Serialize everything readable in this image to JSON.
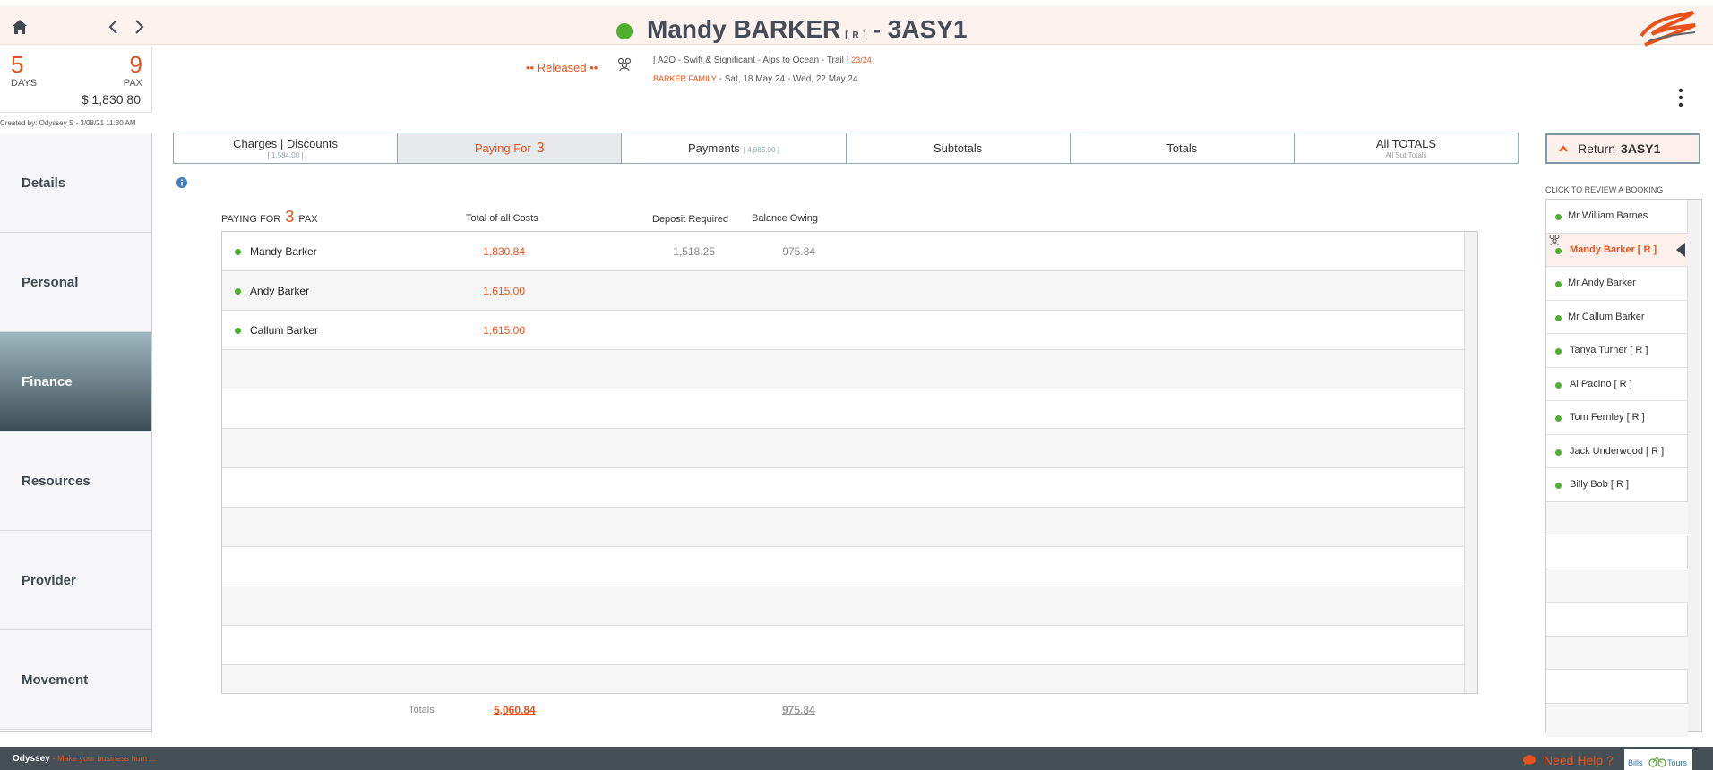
{
  "header": {
    "name": "Mandy BARKER",
    "r_tag": "[ R ]",
    "code": "- 3ASY1",
    "status_color": "#4caf2d"
  },
  "summary": {
    "days": "5",
    "days_label": "DAYS",
    "pax": "9",
    "pax_label": "PAX",
    "amount": "$ 1,830.80",
    "created_by": "Created by: Odyssey S - 3/08/21 11:30 AM"
  },
  "booking": {
    "status": "•• Released ••",
    "trip": "[ A2O - Swift & Significant - Alps to Ocean - Trail ]",
    "trip_ref": "23/24",
    "family": "BARKER FAMILY",
    "dates": "- Sat, 18 May 24 - Wed, 22 May 24"
  },
  "sidebar": {
    "items": [
      {
        "label": "Details"
      },
      {
        "label": "Personal"
      },
      {
        "label": "Finance"
      },
      {
        "label": "Resources"
      },
      {
        "label": "Provider"
      },
      {
        "label": "Movement"
      }
    ]
  },
  "tabs": {
    "charges": "Charges | Discounts",
    "charges_sub": "[ 1,584.00 ]",
    "paying": "Paying For",
    "paying_count": "3",
    "payments": "Payments",
    "payments_sub": "[ 4,085.00 ]",
    "subtotals": "Subtotals",
    "totals": "Totals",
    "all_totals": "All TOTALS",
    "all_totals_sub": "All SubTotals"
  },
  "return_btn": {
    "label": "Return",
    "code": "3ASY1"
  },
  "review": {
    "header": "CLICK TO REVIEW A BOOKING",
    "items": [
      {
        "label": "Mr William Barnes"
      },
      {
        "label": "Mandy Barker  [ R ]"
      },
      {
        "label": "Mr Andy Barker"
      },
      {
        "label": "Mr Callum Barker"
      },
      {
        "label": "Tanya Turner   [ R ]"
      },
      {
        "label": "Al Pacino   [ R ]"
      },
      {
        "label": "Tom Fernley   [ R ]"
      },
      {
        "label": "Jack Underwood   [ R ]"
      },
      {
        "label": "Billy Bob   [ R ]"
      }
    ]
  },
  "table": {
    "paying_for": "PAYING FOR",
    "paying_num": "3",
    "paying_pax": "PAX",
    "col_total": "Total of all Costs",
    "col_deposit": "Deposit Required",
    "col_balance": "Balance Owing",
    "rows": [
      {
        "name": "Mandy Barker",
        "total": "1,830.84",
        "deposit": "1,518.25",
        "balance": "975.84"
      },
      {
        "name": "Andy Barker",
        "total": "1,615.00",
        "deposit": "",
        "balance": ""
      },
      {
        "name": "Callum Barker",
        "total": "1,615.00",
        "deposit": "",
        "balance": ""
      }
    ],
    "totals_label": "Totals",
    "totals_cost": "5,060.84",
    "totals_balance": "975.84"
  },
  "footer": {
    "brand": "Odyssey",
    "tagline": "- Make your business hum ...",
    "help": "Need Help ?",
    "bills_logo": "Bills Tours"
  }
}
